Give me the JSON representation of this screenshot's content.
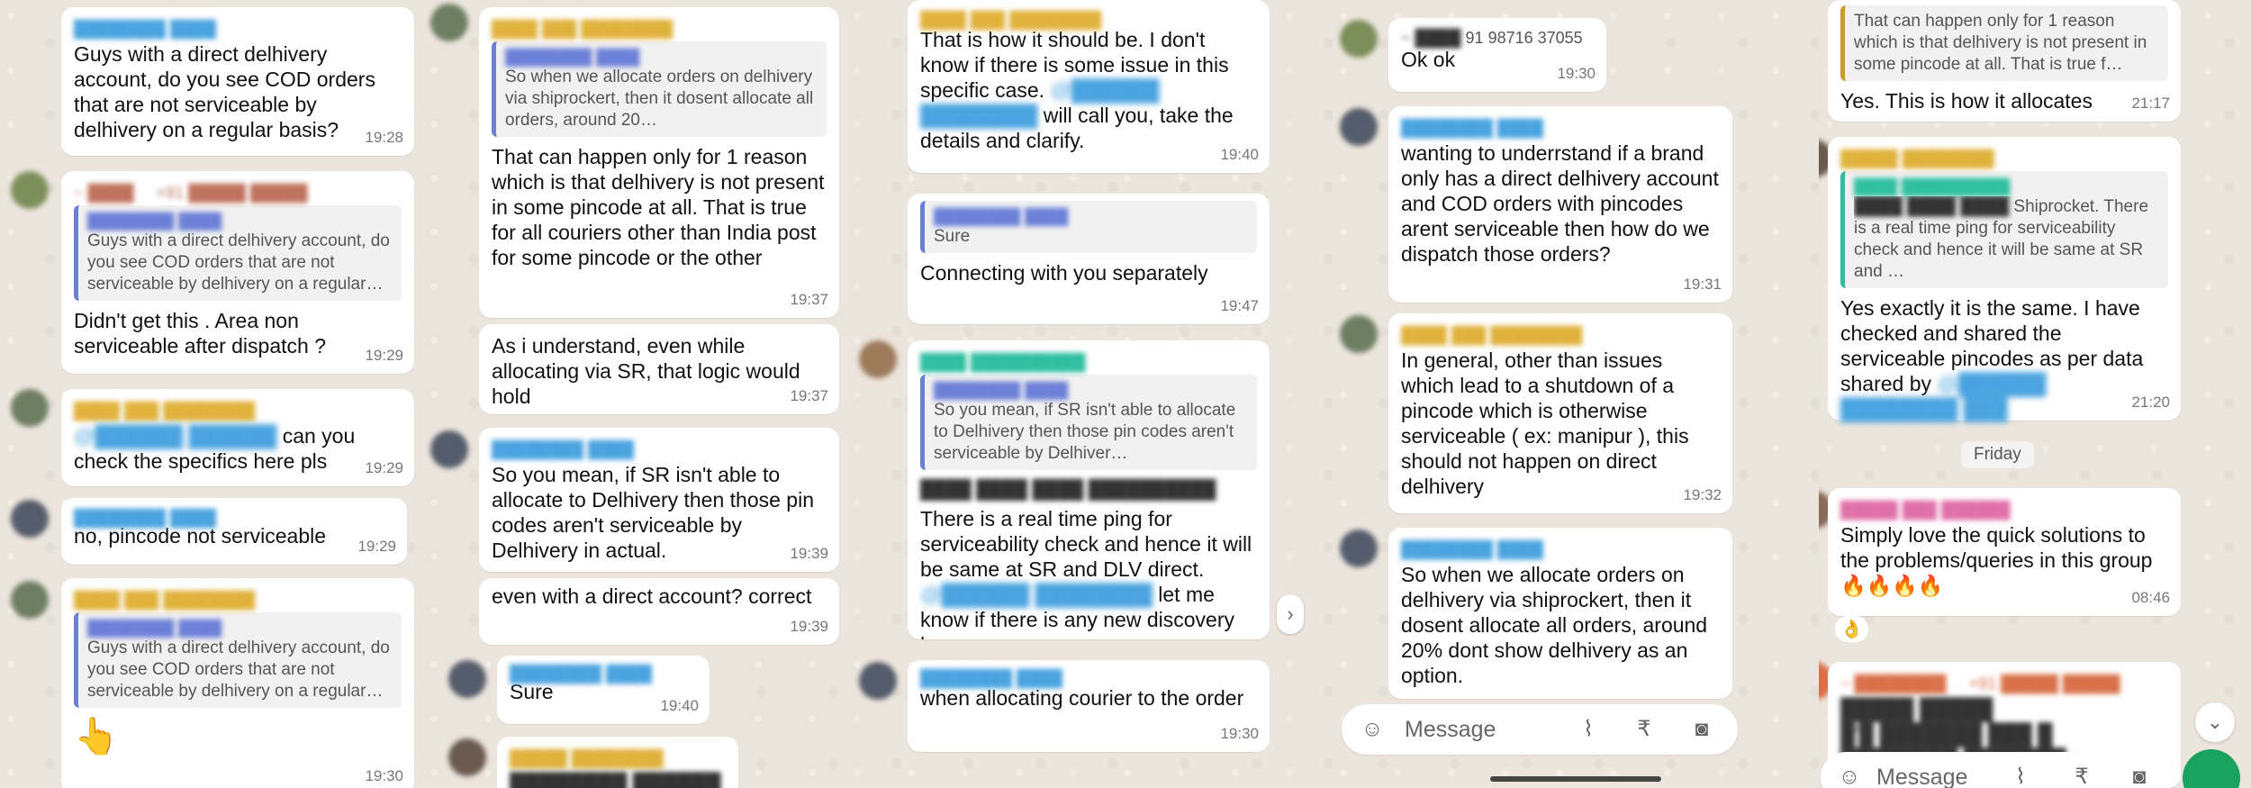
{
  "colors": {
    "chat_bg": "#ece5dd",
    "bubble": "#ffffff",
    "quote_bar": "#6b7fd7",
    "accent_green": "#1aa260"
  },
  "panel1": {
    "m1": {
      "text": "Guys with a direct delhivery account, do you see COD orders that are not serviceable by delhivery on a regular basis?",
      "time": "19:28"
    },
    "m2": {
      "quote": "Guys with a direct delhivery account, do you see COD orders that are not serviceable by delhivery on a regular…",
      "text": "Didn't get this . Area non serviceable after dispatch ?",
      "time": "19:29"
    },
    "m3": {
      "text": "can you check the specifics here pls",
      "time": "19:29"
    },
    "m4": {
      "text": "no, pincode not serviceable",
      "time": "19:29"
    },
    "m5": {
      "quote": "Guys with a direct delhivery account, do you see COD orders that are not serviceable by delhivery on a regular…",
      "emoji": "👆",
      "time": "19:30"
    }
  },
  "panel2": {
    "m1": {
      "quote": "So when we allocate orders on delhivery via shiprockert, then it dosent allocate all orders, around 20…",
      "text": "That can happen only for 1 reason which is that delhivery is not present in some pincode at all. That is true for all couriers other than India post for some pincode or the other",
      "time": "19:37"
    },
    "m2": {
      "text": "As i understand, even while allocating via SR, that logic would hold",
      "time": "19:37"
    },
    "m3": {
      "text": "So you mean, if SR isn't able to allocate to Delhivery then those pin codes aren't serviceable by Delhivery in actual.",
      "time": "19:39"
    },
    "m4": {
      "text": "even with a direct account? correct",
      "time": "19:39"
    },
    "m5": {
      "text": "Sure",
      "time": "19:40"
    }
  },
  "panel3": {
    "m1": {
      "text_a": "That is how it should be. I don't know if there is some issue in this specific case.",
      "text_b": "will call you, take the details and clarify.",
      "time": "19:40"
    },
    "m2": {
      "quote": "Sure",
      "text": "Connecting with you separately",
      "time": "19:47"
    },
    "m3": {
      "quote": "So you mean, if SR isn't able to allocate to Delhivery then those pin codes aren't serviceable by Delhiver…",
      "text": "There is a real time ping for serviceability check and hence it will be same at SR and DLV direct.",
      "text_b": "let me know if there is any new discovery here"
    },
    "m4": {
      "text": "when allocating courier to the order",
      "time": "19:30"
    }
  },
  "panel4": {
    "m1": {
      "phone": "91 98716 37055",
      "text": "Ok ok",
      "time": "19:30"
    },
    "m2": {
      "text": "wanting to underrstand if a brand only has a direct delhivery account and COD orders with pincodes arent serviceable then how do we dispatch those orders?",
      "time": "19:31"
    },
    "m3": {
      "text": "In general, other than issues which lead to a shutdown of a pincode which is otherwise serviceable ( ex: manipur ), this should not happen on direct delhivery",
      "time": "19:32"
    },
    "m4": {
      "text": "So when we allocate orders on delhivery via shiprockert, then it dosent allocate all orders, around 20% dont show delhivery as an option."
    },
    "input": {
      "placeholder": "Message"
    }
  },
  "panel5": {
    "m1": {
      "quote": "That can happen only for 1 reason which is that delhivery is not present in some pincode at all. That is true f…",
      "text": "Yes. This is how it allocates",
      "time": "21:17"
    },
    "m2": {
      "quote": "Shiprocket. There is a real time ping for serviceability check and hence it will be same at SR and …",
      "text": "Yes exactly it is the same. I have checked and shared the serviceable pincodes as per data shared by",
      "time": "21:20"
    },
    "day": "Friday",
    "m3": {
      "text": "Simply love the quick solutions to the problems/queries in this group 🔥🔥🔥🔥",
      "time": "08:46",
      "reaction": "👌"
    },
    "input": {
      "placeholder": "Message"
    }
  }
}
